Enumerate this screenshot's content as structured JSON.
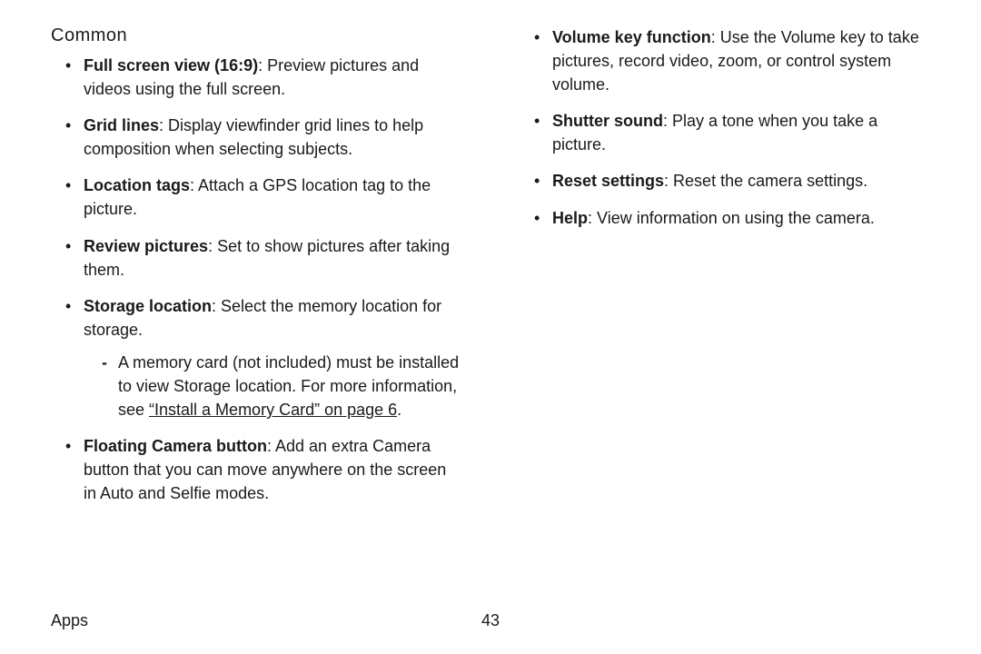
{
  "section_title": "Common",
  "left": {
    "items": [
      {
        "term": "Full screen view (16:9)",
        "desc": ": Preview pictures and videos using the full screen."
      },
      {
        "term": "Grid lines",
        "desc": ": Display viewfinder grid lines to help composition when selecting subjects."
      },
      {
        "term": "Location tags",
        "desc": ": Attach a GPS location tag to the picture."
      },
      {
        "term": "Review pictures",
        "desc": ": Set to show pictures after taking them."
      },
      {
        "term": "Storage location",
        "desc": ": Select the memory location for storage.",
        "sub": {
          "pre": "A memory card (not included) must be installed to view Storage location. For more information, see ",
          "link": "“Install a Memory Card” on page 6",
          "post": "."
        }
      },
      {
        "term": "Floating Camera button",
        "desc": ": Add an extra Camera button that you can move anywhere on the screen in Auto and Selfie modes."
      }
    ]
  },
  "right": {
    "items": [
      {
        "term": "Volume key function",
        "desc": ": Use the Volume key to take pictures, record video, zoom, or control system volume."
      },
      {
        "term": "Shutter sound",
        "desc": ": Play a tone when you take a picture."
      },
      {
        "term": "Reset settings",
        "desc": ": Reset the camera settings."
      },
      {
        "term": "Help",
        "desc": ": View information on using the camera."
      }
    ]
  },
  "footer": {
    "section": "Apps",
    "page": "43"
  }
}
